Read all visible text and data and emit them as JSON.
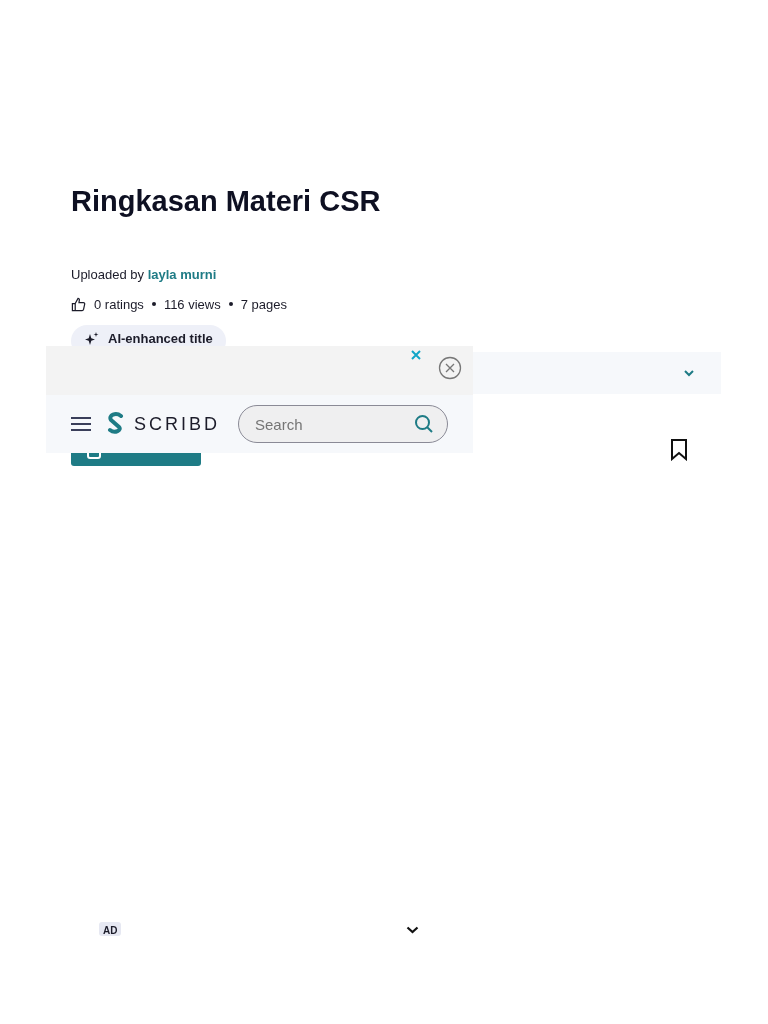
{
  "document": {
    "title": "Ringkasan Materi CSR",
    "uploaded_by_label": "Uploaded by",
    "uploader": "layla murni",
    "ratings": "0 ratings",
    "views": "116 views",
    "pages": "7 pages",
    "ai_chip": "AI-enhanced title"
  },
  "navbar": {
    "logo": "SCRIBD",
    "search": {
      "placeholder": "Search"
    }
  },
  "ad": {
    "badge": "AD"
  }
}
